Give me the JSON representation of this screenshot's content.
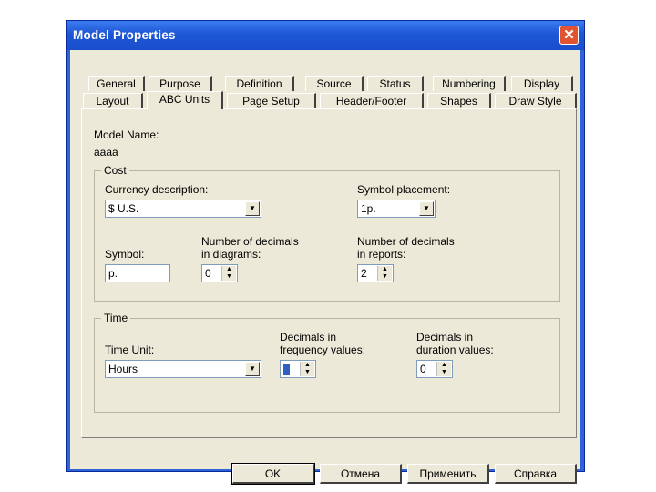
{
  "window": {
    "title": "Model Properties",
    "close_glyph": "✕"
  },
  "tabs_row1": [
    "General",
    "Purpose",
    "Definition",
    "Source",
    "Status",
    "Numbering",
    "Display"
  ],
  "tabs_row2": [
    "Layout",
    "ABC Units",
    "Page Setup",
    "Header/Footer",
    "Shapes",
    "Draw Style"
  ],
  "active_tab": "ABC Units",
  "model": {
    "label": "Model Name:",
    "value": "aaaa"
  },
  "cost": {
    "group_title": "Cost",
    "currency_label": "Currency description:",
    "currency_value": "$ U.S.",
    "placement_label": "Symbol placement:",
    "placement_value": "1p.",
    "symbol_label": "Symbol:",
    "symbol_value": "p.",
    "diagram_decimals_label1": "Number of decimals",
    "diagram_decimals_label2": "in diagrams:",
    "diagram_decimals_value": "0",
    "report_decimals_label1": "Number of decimals",
    "report_decimals_label2": "in reports:",
    "report_decimals_value": "2"
  },
  "time": {
    "group_title": "Time",
    "unit_label": "Time Unit:",
    "unit_value": "Hours",
    "freq_label1": "Decimals in",
    "freq_label2": "frequency values:",
    "freq_value": "0",
    "dur_label1": "Decimals in",
    "dur_label2": "duration values:",
    "dur_value": "0"
  },
  "buttons": {
    "ok": "OK",
    "cancel": "Отмена",
    "apply": "Применить",
    "help": "Справка"
  },
  "colors": {
    "titlebar": "#1e56d6",
    "dialog_bg": "#ece9d8",
    "close": "#e1542f"
  }
}
